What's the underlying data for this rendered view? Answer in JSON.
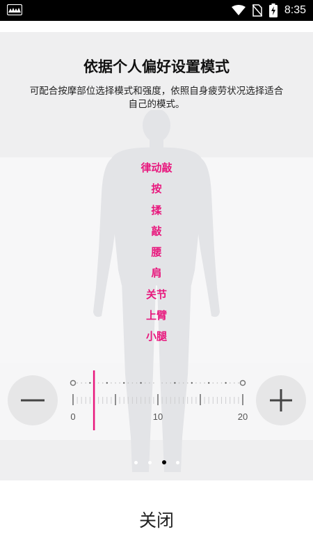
{
  "status_bar": {
    "time": "8:35",
    "icons": [
      "app-notification-icon",
      "wifi-icon",
      "no-sim-icon",
      "battery-charging-icon"
    ]
  },
  "header": {
    "title": "依据个人偏好设置模式",
    "subtitle": "可配合按摩部位选择模式和强度，依照自身疲劳状况选择适合自己的模式。"
  },
  "modes": [
    "律动敲",
    "按",
    "揉",
    "敲",
    "腰",
    "肩",
    "关节",
    "上臂",
    "小腿"
  ],
  "intensity": {
    "min_label": "0",
    "mid_label": "10",
    "max_label": "20",
    "min": 0,
    "max": 20,
    "value": 0.4,
    "decrease_icon": "minus-icon",
    "increase_icon": "plus-icon"
  },
  "pager": {
    "count": 4,
    "active_index": 2
  },
  "footer": {
    "close_label": "关闭"
  },
  "colors": {
    "accent": "#e8177d",
    "panel": "#efeff0",
    "button": "#e6e6e7"
  }
}
